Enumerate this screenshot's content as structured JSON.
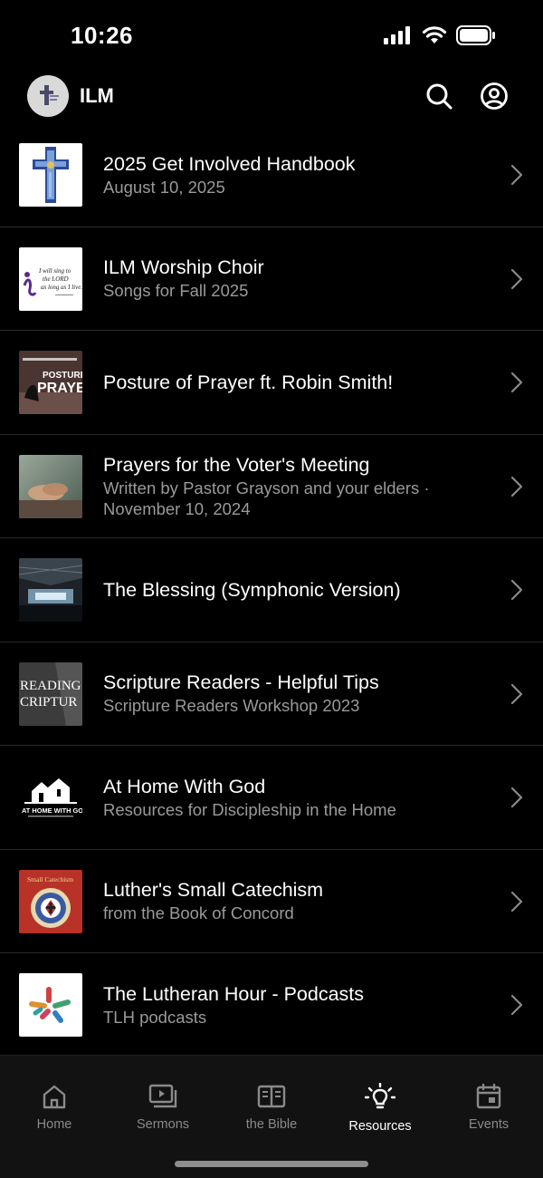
{
  "status_bar": {
    "time": "10:26"
  },
  "header": {
    "app_title": "ILM",
    "search_icon": "search-icon",
    "account_icon": "account-icon"
  },
  "resources": [
    {
      "title": "2025 Get Involved Handbook",
      "subtitle": "August 10, 2025",
      "thumbnail": "cross-painting"
    },
    {
      "title": "ILM Worship Choir",
      "subtitle": "Songs for Fall 2025",
      "thumbnail": "choir-script",
      "thumb_text": "I will sing to the LORD as long as I live."
    },
    {
      "title": "Posture of Prayer ft. Robin Smith!",
      "subtitle": "",
      "thumbnail": "posture-prayer",
      "thumb_text": "POSTURE OF PRAYER"
    },
    {
      "title": "Prayers for the Voter's Meeting",
      "subtitle": "Written by Pastor Grayson and your elders · November 10, 2024",
      "thumbnail": "praying-hands"
    },
    {
      "title": "The Blessing (Symphonic Version)",
      "subtitle": "",
      "thumbnail": "concert-stage"
    },
    {
      "title": "Scripture Readers - Helpful Tips",
      "subtitle": "Scripture Readers Workshop 2023",
      "thumbnail": "reading-scripture",
      "thumb_text": "READING CRIPTUR"
    },
    {
      "title": "At Home With God",
      "subtitle": "Resources for Discipleship in the Home",
      "thumbnail": "home-with-god",
      "thumb_text": "AT HOME WITH GOD"
    },
    {
      "title": "Luther's Small Catechism",
      "subtitle": "from the Book of Concord",
      "thumbnail": "catechism-seal",
      "thumb_text": "Small Catechism"
    },
    {
      "title": "The Lutheran Hour - Podcasts",
      "subtitle": "TLH podcasts",
      "thumbnail": "tlh-logo"
    }
  ],
  "tabs": [
    {
      "label": "Home",
      "icon": "home-icon"
    },
    {
      "label": "Sermons",
      "icon": "sermons-icon"
    },
    {
      "label": "the Bible",
      "icon": "bible-icon"
    },
    {
      "label": "Resources",
      "icon": "lightbulb-icon",
      "active": true
    },
    {
      "label": "Events",
      "icon": "calendar-icon"
    }
  ],
  "colors": {
    "background": "#000000",
    "text": "#ffffff",
    "subtext": "#9a9a9a",
    "tab_inactive": "#8a8a8a",
    "tab_bar": "#121212"
  }
}
